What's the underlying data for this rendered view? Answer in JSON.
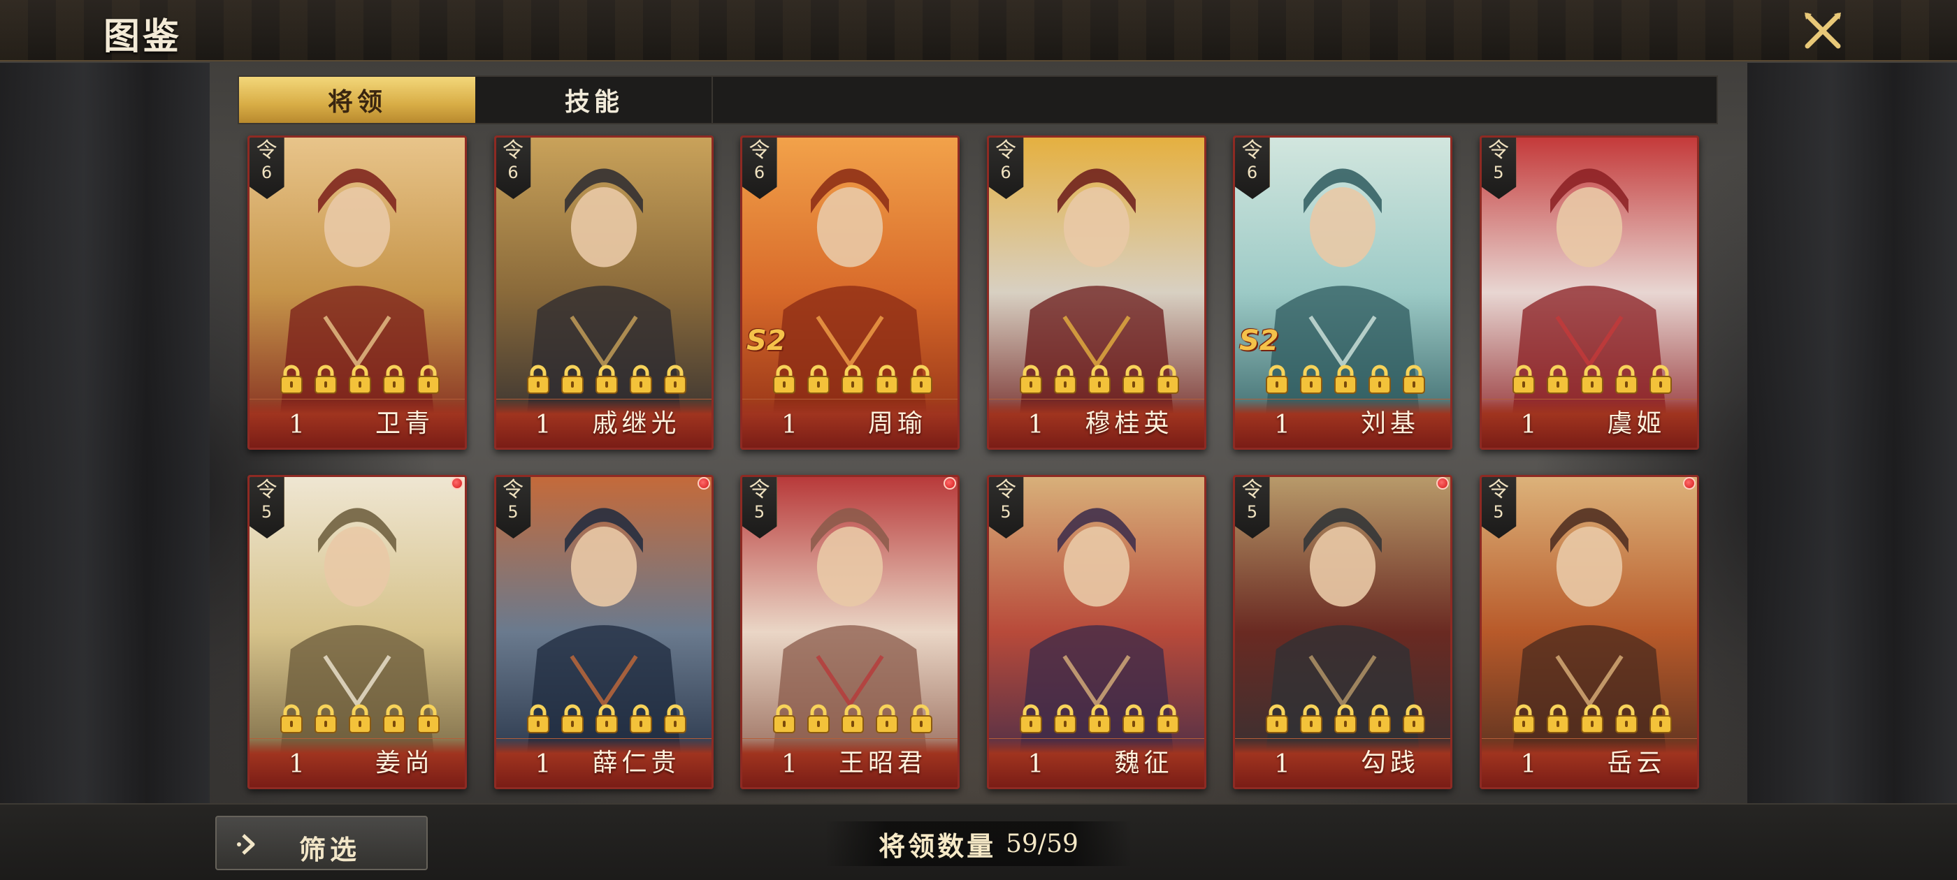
{
  "header": {
    "title": "图鉴",
    "close_icon": "close-x-icon"
  },
  "tabs": [
    {
      "label": "将领",
      "active": true
    },
    {
      "label": "技能",
      "active": false
    }
  ],
  "cost_symbol": "令",
  "generals": [
    {
      "name": "卫青",
      "level": "1",
      "cost": "6",
      "badge": "",
      "new_dot": false,
      "locks": 5,
      "palette": [
        "#7a1e1a",
        "#c6954a",
        "#e8c48a"
      ]
    },
    {
      "name": "戚继光",
      "level": "1",
      "cost": "6",
      "badge": "",
      "new_dot": false,
      "locks": 5,
      "palette": [
        "#2b2a30",
        "#8a6a3a",
        "#c9a25a"
      ]
    },
    {
      "name": "周瑜",
      "level": "1",
      "cost": "6",
      "badge": "S2",
      "new_dot": false,
      "locks": 5,
      "palette": [
        "#8a2a14",
        "#d86a2a",
        "#f2a24a"
      ]
    },
    {
      "name": "穆桂英",
      "level": "1",
      "cost": "6",
      "badge": "",
      "new_dot": false,
      "locks": 5,
      "palette": [
        "#6a1a1a",
        "#d8d0c2",
        "#e5b040"
      ]
    },
    {
      "name": "刘基",
      "level": "1",
      "cost": "6",
      "badge": "S2",
      "new_dot": false,
      "locks": 5,
      "palette": [
        "#2e5a5e",
        "#9ccac6",
        "#d2e6de"
      ]
    },
    {
      "name": "虞姬",
      "level": "1",
      "cost": "5",
      "badge": "",
      "new_dot": false,
      "locks": 5,
      "palette": [
        "#8a1e22",
        "#e8d6d2",
        "#c43a3a"
      ]
    },
    {
      "name": "姜尚",
      "level": "1",
      "cost": "5",
      "badge": "",
      "new_dot": true,
      "locks": 5,
      "palette": [
        "#6a5a3a",
        "#d6c28a",
        "#efe6d2"
      ]
    },
    {
      "name": "薛仁贵",
      "level": "1",
      "cost": "5",
      "badge": "",
      "new_dot": true,
      "locks": 5,
      "palette": [
        "#1e2a3e",
        "#6a7a8e",
        "#c46a3a"
      ]
    },
    {
      "name": "王昭君",
      "level": "1",
      "cost": "5",
      "badge": "",
      "new_dot": true,
      "locks": 5,
      "palette": [
        "#8a5a4a",
        "#ead6c6",
        "#b83a3a"
      ]
    },
    {
      "name": "魏征",
      "level": "1",
      "cost": "5",
      "badge": "",
      "new_dot": false,
      "locks": 5,
      "palette": [
        "#3a2a4a",
        "#b84a3a",
        "#d8b07a"
      ]
    },
    {
      "name": "勾践",
      "level": "1",
      "cost": "5",
      "badge": "",
      "new_dot": true,
      "locks": 5,
      "palette": [
        "#2e3236",
        "#6a2a22",
        "#b89a6a"
      ]
    },
    {
      "name": "岳云",
      "level": "1",
      "cost": "5",
      "badge": "",
      "new_dot": true,
      "locks": 5,
      "palette": [
        "#4a2a1e",
        "#b85a2a",
        "#dcb27a"
      ]
    }
  ],
  "footer": {
    "filter_label": "筛选",
    "filter_icon": "arrow-right-icon",
    "count_label": "将领数量",
    "count_value": "59/59"
  },
  "colors": {
    "accent_gold": "#d8ad46",
    "card_border": "#8e2a23",
    "lock_gold": "#f3c23a"
  }
}
